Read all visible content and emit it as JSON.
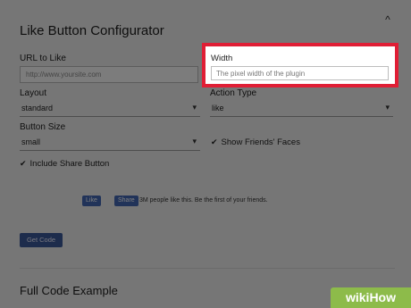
{
  "dialog": {
    "title": "Like Button Configurator",
    "close_glyph": "^",
    "url_label": "URL to Like",
    "url_placeholder": "http://www.yoursite.com",
    "width_label": "Width",
    "width_placeholder": "The pixel width of the plugin",
    "layout_label": "Layout",
    "layout_value": "standard",
    "action_label": "Action Type",
    "action_value": "like",
    "size_label": "Button Size",
    "size_value": "small",
    "faces_label": "Show Friends' Faces",
    "share_label": "Include Share Button",
    "tick": "✔",
    "chevron": "▾"
  },
  "preview": {
    "like_label": "Like",
    "share_label": "Share",
    "social_text": "3M people like this. Be the first of your friends."
  },
  "actions": {
    "get_code": "Get Code"
  },
  "section": {
    "full_code_title": "Full Code Example"
  },
  "watermark": {
    "text": "wikiHow"
  },
  "colors": {
    "highlight": "#e01e35",
    "fb_blue": "#4267b2",
    "overlay": "#000000"
  }
}
